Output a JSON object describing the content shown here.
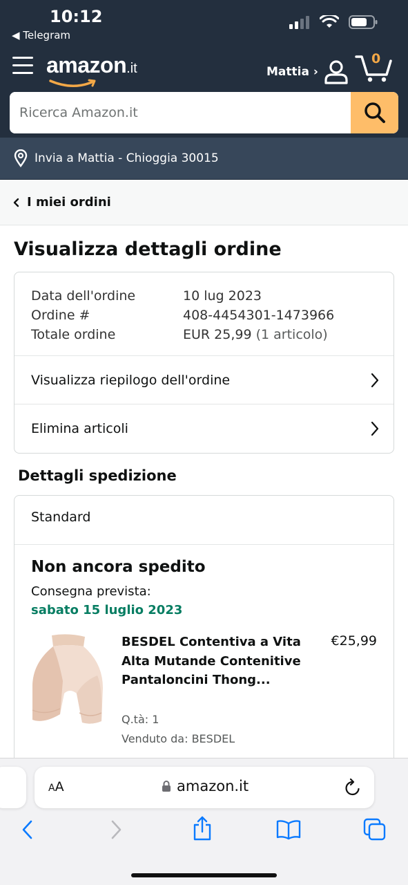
{
  "status_bar": {
    "time": "10:12",
    "back_app": "◀ Telegram"
  },
  "header": {
    "logo_text": "amazon",
    "logo_tld": ".it",
    "account_label": "Mattia ›",
    "cart_count": "0",
    "search_placeholder": "Ricerca Amazon.it",
    "deliver_to": "Invia a Mattia - Chioggia 30015",
    "colors": {
      "header_bg": "#232f3e",
      "deliver_bg": "#37475a",
      "search_button": "#febd69",
      "cart_count": "#f3a847"
    }
  },
  "breadcrumb": {
    "back_label": "I miei ordini"
  },
  "page_title": "Visualizza dettagli ordine",
  "order_summary": {
    "date_label": "Data dell'ordine",
    "date_value": "10 lug 2023",
    "order_label": "Ordine #",
    "order_value": "408-4454301-1473966",
    "total_label": "Totale ordine",
    "total_value": "EUR 25,99",
    "total_count": "(1 articolo)",
    "links": [
      {
        "label": "Visualizza riepilogo dell'ordine"
      },
      {
        "label": "Elimina articoli"
      }
    ]
  },
  "shipping": {
    "section_title": "Dettagli spedizione",
    "method": "Standard",
    "status": "Non ancora spedito",
    "delivery_label": "Consegna prevista:",
    "delivery_date": "sabato 15 luglio 2023",
    "delivery_color": "#067d62",
    "item": {
      "title": "BESDEL Contentiva a Vita Alta Mutande Contenitive Pantaloncini Thong...",
      "price": "€25,99",
      "quantity": "Q.tà: 1",
      "seller": "Venduto da: BESDEL"
    }
  },
  "browser": {
    "text_size_small": "A",
    "text_size_large": "A",
    "url": "amazon.it"
  }
}
